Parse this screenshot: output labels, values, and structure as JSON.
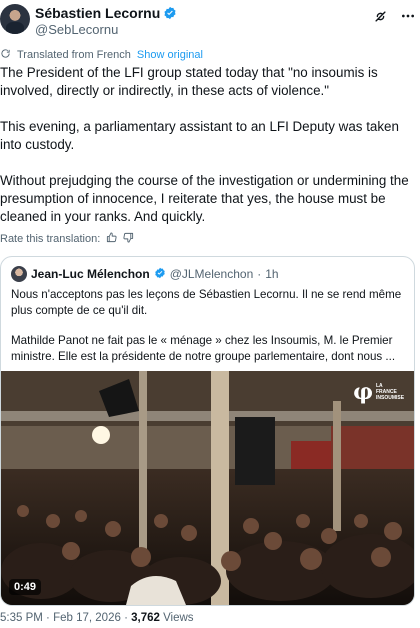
{
  "author": {
    "display_name": "Sébastien Lecornu",
    "handle": "@SebLecornu"
  },
  "translation": {
    "label": "Translated from French",
    "show_original": "Show original",
    "rate_label": "Rate this translation:"
  },
  "tweet": {
    "paragraphs": [
      "The President of the LFI group stated today that \"no insoumis is involved, directly or indirectly, in these acts of violence.\"",
      "This evening, a parliamentary assistant to an LFI Deputy was taken into custody.",
      "Without prejudging the course of the investigation or undermining the presumption of innocence, I reiterate that yes, the house must be cleaned in your ranks. And quickly."
    ]
  },
  "quote": {
    "display_name": "Jean-Luc Mélenchon",
    "handle": "@JLMelenchon",
    "separator": "·",
    "time": "1h",
    "paragraphs": [
      "Nous n'acceptons pas les leçons de Sébastien Lecornu. Il ne se rend même plus compte de ce qu'il dit.",
      "Mathilde Panot ne fait pas le « ménage » chez les Insoumis, M. le Premier ministre. Elle est la présidente de notre groupe parlementaire, dont nous ..."
    ],
    "media": {
      "duration": "0:49",
      "watermark_symbol": "φ",
      "watermark_text": "LA FRANCE INSOUMISE"
    }
  },
  "meta": {
    "time": "5:35 PM",
    "dot": "·",
    "date": "Feb 17, 2026",
    "views_count": "3,762",
    "views_label": "Views"
  },
  "colors": {
    "link": "#1d9bf0",
    "muted": "#536471",
    "border": "#cfd9de",
    "verified": "#1d9bf0"
  },
  "icons": {
    "verified": "verified-badge-icon",
    "grok": "grok-icon",
    "more": "more-icon",
    "translate": "translate-icon",
    "thumbs_up": "thumbs-up-icon",
    "thumbs_down": "thumbs-down-icon"
  }
}
